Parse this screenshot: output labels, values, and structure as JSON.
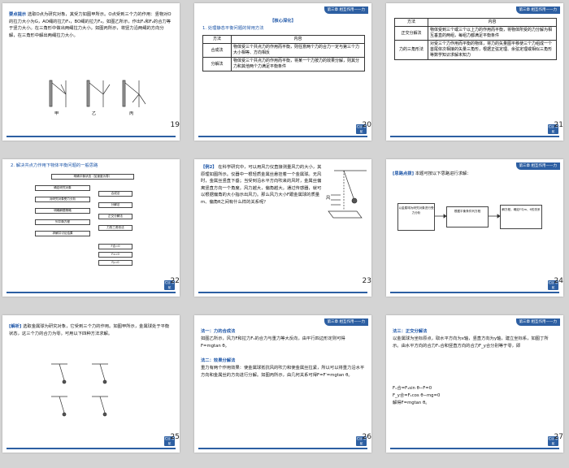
{
  "header_label": "第三章  相互作用——力",
  "footer_button": "栏目\n导航",
  "page_numbers": [
    "19",
    "20",
    "21",
    "22",
    "23",
    "24",
    "25",
    "26",
    "27"
  ],
  "s19": {
    "tag": "要点提示",
    "text": "选取O点为研究对象，其受力如图甲所示。O点受到三个力的作用：竖物对O的拉力大小为G，AO绳的拉力F₁，BO绳的拉力F₂。如图乙所示，作出F₁和F₂的合力等于竖力大小。在三角形中做出两绳拉力大小。如图丙所示，将竖力沿两绳的方向分解，在三角形中解出两绳拉力大小。",
    "labels": [
      "甲",
      "乙",
      "丙"
    ]
  },
  "s20": {
    "heading": "【核心深化】",
    "subheading": "1. 处理静态平衡问题的常用方法",
    "columns": [
      "方法",
      "内容"
    ],
    "rows": [
      {
        "method": "合成法",
        "content": "物体受三个共点力的作用而平衡，则任意两个力的合力一定与第三个力大小相等、方向相反"
      },
      {
        "method": "分解法",
        "content": "物体受三个共点力的作用而平衡，将某一个力按力的效果分解，则其分力和其他两个力满足平衡条件"
      }
    ]
  },
  "s21": {
    "columns": [
      "方法",
      "内容"
    ],
    "rows": [
      {
        "method": "正交分解法",
        "content": "物体受到三个或三个以上力的作用而平衡，将物体所受的力分解为相互垂直的两组，每组力都满足平衡条件"
      },
      {
        "method": "力的三角形法",
        "content": "对受三个力作用而平衡的物体，将力的矢量图平移使三个力组成一个首尾依次相接的矢量三角形，根据正弦定理、余弦定理或相似三角形等数学知识求解未知力"
      }
    ]
  },
  "s22": {
    "heading": "2. 解决共点力作用下物体平衡问题的一般思路",
    "flow": {
      "top": "明确平衡状态（加速度为零）",
      "left": [
        "巧选研究对象（整体法和隔离法）",
        "受力分析（规范画出受力示意图）",
        "建立平衡方程（灵活运用力的合成法、效果分解法、正交分解法）",
        "求解或讨论（解的结果及物理意义）"
      ],
      "mid": [
        "确定研究对象",
        "对研究对象受力分析",
        "明确解题策略",
        "列平衡方程",
        "求解并讨论结果"
      ],
      "right": [
        "合成法",
        "分解法",
        "正交分解法",
        "力的三角形法",
        "F合=0",
        "Fx=0",
        "Fy=0"
      ]
    }
  },
  "s23": {
    "tag": "【例2】",
    "text": "在科学研究中，可以用风力仪直接测量风力的大小，其原理如图所示。仪器中一根轻质金属丝悬挂着一个金属球。无风时，金属丝竖直下垂；当受到沿水平方向吹来的风时，金属丝偏离竖直方向一个角度。风力越大，偏角越大。通过传感器，就可以根据偏角的大小指示出风力。那么风力大小F跟金属球的质量m、偏角θ之间有什么样的关系呢？",
    "wind_label": "风"
  },
  "s24": {
    "tag": "[思路点拨]",
    "text": "本题可按以下思路进行求解：",
    "boxes": [
      "以金属球为研究对象进行受力分析",
      "根据平衡条件列方程",
      "解方程，确定F与m、θ的关系"
    ]
  },
  "s25": {
    "tag": "[解析]",
    "text": "选取金属球为研究对象，它受到三个力的作用。如图甲所示，金属球处于平衡状态，这三个力的合力为零。可用以下四种方法求解。"
  },
  "s26": {
    "m1_title": "法一：力的合成法",
    "m1_text": "如图乙所示，风力F和拉力F₁的合力与重力等大反向，由平行四边形定则可得F=mgtan θ。",
    "m2_title": "法二：效果分解法",
    "m2_text": "重力有两个作用效果：使金属球抵抗风的吹力和使金属丝拉紧，所以可以将重力沿水平方向和金属丝的方向进行分解。如图丙所示，由几何关系可得F=F′=mgtan θ。"
  },
  "s27": {
    "m3_title": "法三：正交分解法",
    "m3_text": "以金属球为坐标原点，取水平方向为x轴，竖直方向为y轴，建立坐标系，如图丁所示。由水平方向的合力Fₓ合和竖直方向的合力F_y合分别等于零，即",
    "eq1": "Fₓ合=F₁sin θ−F=0",
    "eq2": "F_y合=F₁cos θ−mg=0",
    "result": "解得F=mgtan θ。"
  }
}
